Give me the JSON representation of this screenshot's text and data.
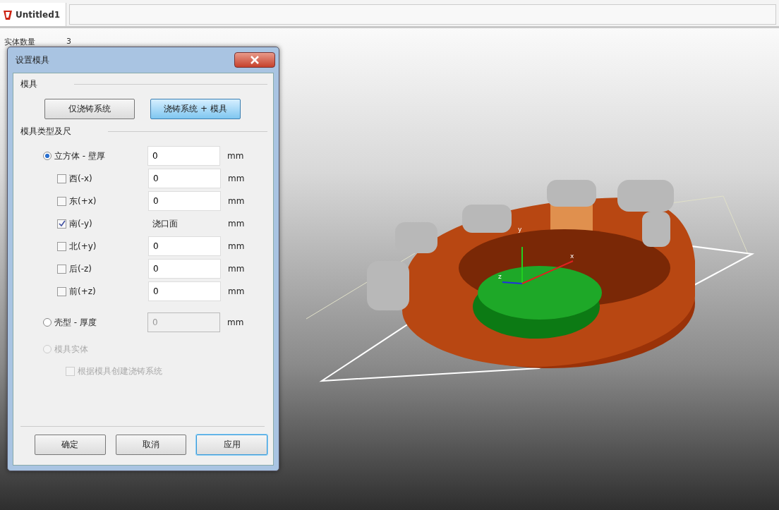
{
  "tab": {
    "title": "Untitled1",
    "selected": true
  },
  "info": {
    "label": "实体数量",
    "value": "3"
  },
  "viewport": {
    "axis_labels": [
      "y",
      "x",
      "z"
    ]
  },
  "dialog": {
    "title": "设置模具",
    "mold_section": "模具",
    "mode_buttons": [
      {
        "label": "仅浇铸系统",
        "selected": false
      },
      {
        "label": "浇铸系统 + 模具",
        "selected": true
      }
    ],
    "type_section": "模具类型及尺",
    "options": [
      {
        "kind": "radio",
        "label": "立方体 - 壁厚",
        "selected": true,
        "disabled": false,
        "value": {
          "kind": "field",
          "text": "0",
          "disabled": false
        },
        "unit": "mm"
      },
      {
        "kind": "checkbox",
        "label": "西(-x)",
        "checked": false,
        "disabled": false,
        "value": {
          "kind": "field",
          "text": "0",
          "disabled": false
        },
        "unit": "mm"
      },
      {
        "kind": "checkbox",
        "label": "东(+x)",
        "checked": false,
        "disabled": false,
        "value": {
          "kind": "field",
          "text": "0",
          "disabled": false
        },
        "unit": "mm"
      },
      {
        "kind": "checkbox",
        "label": "南(-y)",
        "checked": true,
        "disabled": false,
        "value": {
          "kind": "text",
          "text": "浇口面"
        },
        "unit": "mm"
      },
      {
        "kind": "checkbox",
        "label": "北(+y)",
        "checked": false,
        "disabled": false,
        "value": {
          "kind": "field",
          "text": "0",
          "disabled": false
        },
        "unit": "mm"
      },
      {
        "kind": "checkbox",
        "label": "后(-z)",
        "checked": false,
        "disabled": false,
        "value": {
          "kind": "field",
          "text": "0",
          "disabled": false
        },
        "unit": "mm"
      },
      {
        "kind": "checkbox",
        "label": "前(+z)",
        "checked": false,
        "disabled": false,
        "value": {
          "kind": "field",
          "text": "0",
          "disabled": false
        },
        "unit": "mm"
      },
      {
        "kind": "radio",
        "label": "壳型 - 厚度",
        "selected": false,
        "disabled": false,
        "value": {
          "kind": "field",
          "text": "0",
          "disabled": true
        },
        "unit": "mm"
      },
      {
        "kind": "radio",
        "label": "模具实体",
        "selected": false,
        "disabled": true
      },
      {
        "kind": "subcheckbox",
        "label": "根据模具创建浇铸系统",
        "checked": false,
        "disabled": true
      }
    ],
    "footer_buttons": [
      {
        "label": "确定",
        "focused": false
      },
      {
        "label": "取消",
        "focused": false
      },
      {
        "label": "应用",
        "focused": true
      }
    ]
  }
}
